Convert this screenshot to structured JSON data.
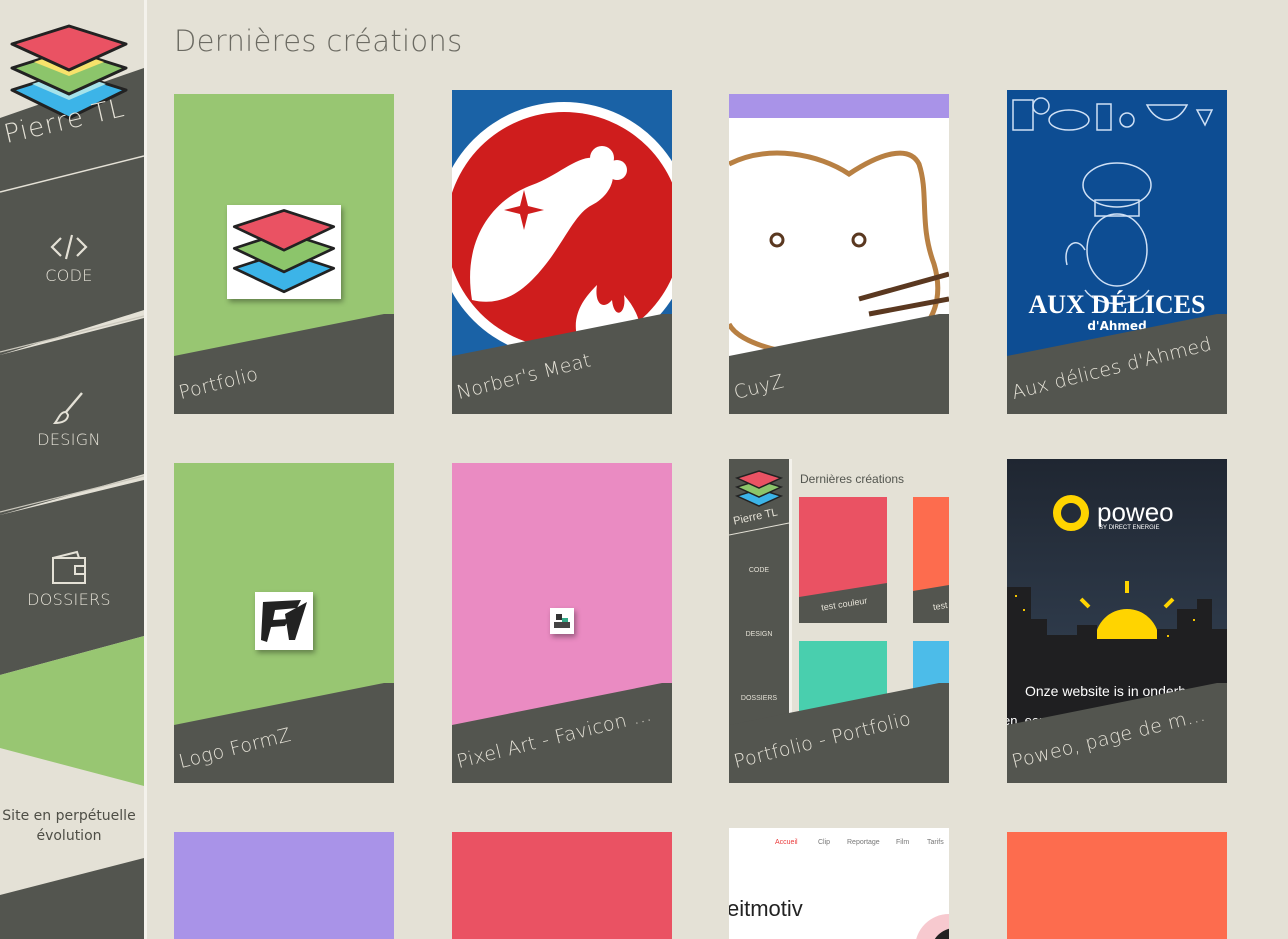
{
  "sidebar": {
    "brand": "Pierre TL",
    "nav": [
      {
        "label": "CODE",
        "icon": "code-icon"
      },
      {
        "label": "DESIGN",
        "icon": "brush-icon"
      },
      {
        "label": "DOSSIERS",
        "icon": "wallet-icon"
      }
    ],
    "footer_note_line1": "Site en perpétuelle",
    "footer_note_line2": "évolution"
  },
  "main": {
    "title": "Dernières créations",
    "cards": [
      {
        "caption": "Portfolio",
        "bg": "#98c672"
      },
      {
        "caption": "Norber's Meat",
        "bg": "#cf1d1d"
      },
      {
        "caption": "CuyZ",
        "bg": "#ffffff"
      },
      {
        "caption": "Aux délices d'Ahmed",
        "bg": "#0d4d93"
      },
      {
        "caption": "Logo FormZ",
        "bg": "#98c672"
      },
      {
        "caption": "Pixel Art - Favicon ...",
        "bg": "#ea8bc2"
      },
      {
        "caption": "Portfolio - Portfolio",
        "bg": "#e4e1d6"
      },
      {
        "caption": "Poweo, page de maintenance",
        "bg": "#27303d"
      },
      {
        "caption": "",
        "bg": "#a993e8"
      },
      {
        "caption": "",
        "bg": "#ea5263"
      },
      {
        "caption": "",
        "bg": "#ffffff"
      },
      {
        "caption": "",
        "bg": "#fd6c4e"
      }
    ],
    "art_text": {
      "delices_main": "AUX DÉLICES",
      "delices_sub": "d'Ahmed",
      "mini_title": "Dernières créations",
      "mini_brand": "Pierre TL",
      "mini_code": "CODE",
      "mini_design": "DESIGN",
      "mini_dossiers": "DOSSIERS",
      "mini_card1": "test couleur",
      "mini_card2": "test",
      "poweo_brand": "poweo",
      "poweo_sub": "BY DIRECT ENERGIE",
      "poweo_line1": "Onze website is in onderh",
      "poweo_line2": "en, een nieuw",
      "nav_accueil": "Accueil",
      "nav_clip": "Clip",
      "nav_reportage": "Reportage",
      "nav_film": "Film",
      "nav_tarifs": "Tarifs",
      "leitmotiv": "eitmotiv"
    }
  }
}
